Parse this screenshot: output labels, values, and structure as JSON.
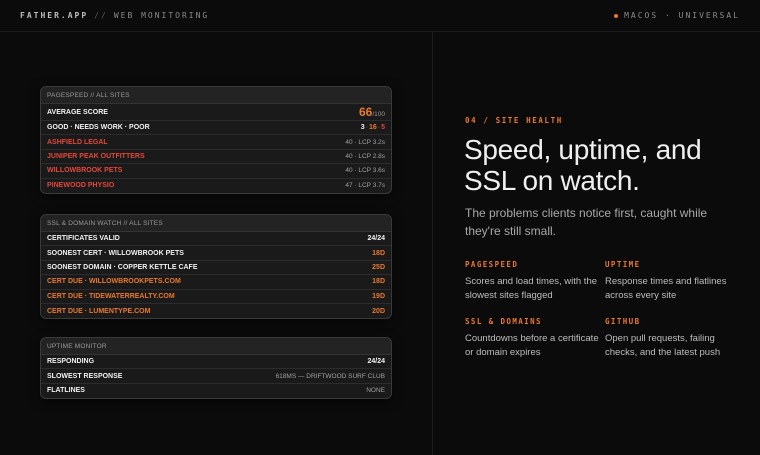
{
  "header": {
    "brand": "FATHER.APP",
    "separator": "//",
    "section": "WEB MONITORING",
    "platform": "MACOS · UNIVERSAL"
  },
  "pagespeed": {
    "title": "PAGESPEED // ALL SITES",
    "average_label": "AVERAGE SCORE",
    "average_score": "66",
    "average_of": "/100",
    "breakdown_label": "GOOD · NEEDS WORK · POOR",
    "good": "3",
    "needs_work": "16",
    "poor": "5",
    "sites": [
      {
        "name": "ASHFIELD LEGAL",
        "metric": "40 · LCP 3.2s"
      },
      {
        "name": "JUNIPER PEAK OUTFITTERS",
        "metric": "40 · LCP 2.8s"
      },
      {
        "name": "WILLOWBROOK PETS",
        "metric": "40 · LCP 3.6s"
      },
      {
        "name": "PINEWOOD PHYSIO",
        "metric": "47 · LCP 3.7s"
      }
    ]
  },
  "ssl": {
    "title": "SSL & DOMAIN WATCH // ALL SITES",
    "rows": [
      {
        "label": "CERTIFICATES VALID",
        "value": "24/24"
      },
      {
        "label": "SOONEST CERT · WILLOWBROOK PETS",
        "value": "18D"
      },
      {
        "label": "SOONEST DOMAIN · COPPER KETTLE CAFE",
        "value": "25D"
      },
      {
        "label": "CERT DUE · WILLOWBROOKPETS.COM",
        "value": "18D"
      },
      {
        "label": "CERT DUE · TIDEWATERREALTY.COM",
        "value": "19D"
      },
      {
        "label": "CERT DUE · LUMENTYPE.COM",
        "value": "20D"
      }
    ]
  },
  "uptime": {
    "title": "UPTIME MONITOR",
    "rows": [
      {
        "label": "RESPONDING",
        "value": "24/24"
      },
      {
        "label": "SLOWEST RESPONSE",
        "value": "618MS — DRIFTWOOD SURF CLUB"
      },
      {
        "label": "FLATLINES",
        "value": "NONE"
      }
    ]
  },
  "hero": {
    "kicker": "04 / SITE HEALTH",
    "headline": "Speed, uptime, and SSL on watch.",
    "subhead": "The problems clients notice first, caught while they're still small."
  },
  "features": [
    {
      "title": "PAGESPEED",
      "body": "Scores and load times, with the slowest sites flagged"
    },
    {
      "title": "UPTIME",
      "body": "Response times and flatlines across every site"
    },
    {
      "title": "SSL & DOMAINS",
      "body": "Countdowns before a certificate or domain expires"
    },
    {
      "title": "GITHUB",
      "body": "Open pull requests, failing checks, and the latest push"
    }
  ],
  "colors": {
    "accent": "#e9792f",
    "alert": "#e2473a",
    "background": "#0b0b0b",
    "card": "#1a1a1a"
  }
}
